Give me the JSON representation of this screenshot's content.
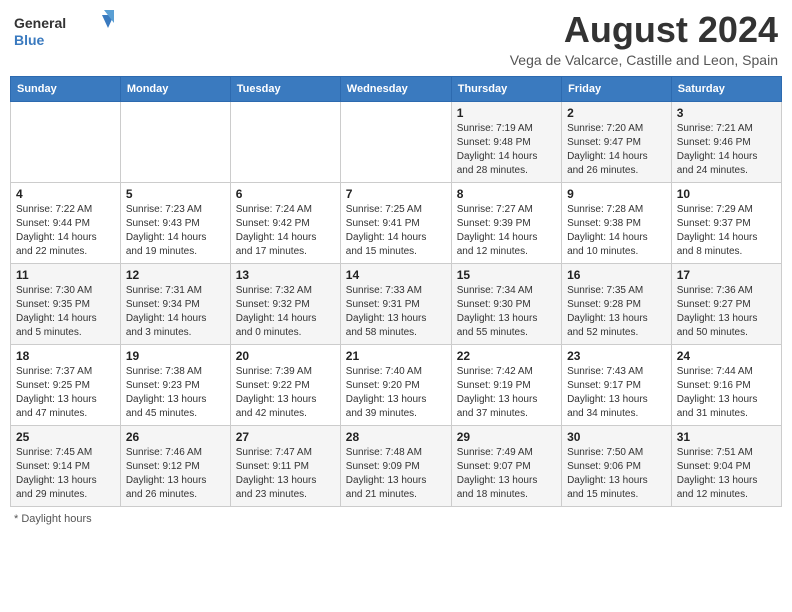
{
  "header": {
    "logo_text_top": "General",
    "logo_text_bottom": "Blue",
    "month_title": "August 2024",
    "location": "Vega de Valcarce, Castille and Leon, Spain"
  },
  "days_of_week": [
    "Sunday",
    "Monday",
    "Tuesday",
    "Wednesday",
    "Thursday",
    "Friday",
    "Saturday"
  ],
  "weeks": [
    [
      {
        "num": "",
        "sunrise": "",
        "sunset": "",
        "daylight": ""
      },
      {
        "num": "",
        "sunrise": "",
        "sunset": "",
        "daylight": ""
      },
      {
        "num": "",
        "sunrise": "",
        "sunset": "",
        "daylight": ""
      },
      {
        "num": "",
        "sunrise": "",
        "sunset": "",
        "daylight": ""
      },
      {
        "num": "1",
        "sunrise": "Sunrise: 7:19 AM",
        "sunset": "Sunset: 9:48 PM",
        "daylight": "Daylight: 14 hours and 28 minutes."
      },
      {
        "num": "2",
        "sunrise": "Sunrise: 7:20 AM",
        "sunset": "Sunset: 9:47 PM",
        "daylight": "Daylight: 14 hours and 26 minutes."
      },
      {
        "num": "3",
        "sunrise": "Sunrise: 7:21 AM",
        "sunset": "Sunset: 9:46 PM",
        "daylight": "Daylight: 14 hours and 24 minutes."
      }
    ],
    [
      {
        "num": "4",
        "sunrise": "Sunrise: 7:22 AM",
        "sunset": "Sunset: 9:44 PM",
        "daylight": "Daylight: 14 hours and 22 minutes."
      },
      {
        "num": "5",
        "sunrise": "Sunrise: 7:23 AM",
        "sunset": "Sunset: 9:43 PM",
        "daylight": "Daylight: 14 hours and 19 minutes."
      },
      {
        "num": "6",
        "sunrise": "Sunrise: 7:24 AM",
        "sunset": "Sunset: 9:42 PM",
        "daylight": "Daylight: 14 hours and 17 minutes."
      },
      {
        "num": "7",
        "sunrise": "Sunrise: 7:25 AM",
        "sunset": "Sunset: 9:41 PM",
        "daylight": "Daylight: 14 hours and 15 minutes."
      },
      {
        "num": "8",
        "sunrise": "Sunrise: 7:27 AM",
        "sunset": "Sunset: 9:39 PM",
        "daylight": "Daylight: 14 hours and 12 minutes."
      },
      {
        "num": "9",
        "sunrise": "Sunrise: 7:28 AM",
        "sunset": "Sunset: 9:38 PM",
        "daylight": "Daylight: 14 hours and 10 minutes."
      },
      {
        "num": "10",
        "sunrise": "Sunrise: 7:29 AM",
        "sunset": "Sunset: 9:37 PM",
        "daylight": "Daylight: 14 hours and 8 minutes."
      }
    ],
    [
      {
        "num": "11",
        "sunrise": "Sunrise: 7:30 AM",
        "sunset": "Sunset: 9:35 PM",
        "daylight": "Daylight: 14 hours and 5 minutes."
      },
      {
        "num": "12",
        "sunrise": "Sunrise: 7:31 AM",
        "sunset": "Sunset: 9:34 PM",
        "daylight": "Daylight: 14 hours and 3 minutes."
      },
      {
        "num": "13",
        "sunrise": "Sunrise: 7:32 AM",
        "sunset": "Sunset: 9:32 PM",
        "daylight": "Daylight: 14 hours and 0 minutes."
      },
      {
        "num": "14",
        "sunrise": "Sunrise: 7:33 AM",
        "sunset": "Sunset: 9:31 PM",
        "daylight": "Daylight: 13 hours and 58 minutes."
      },
      {
        "num": "15",
        "sunrise": "Sunrise: 7:34 AM",
        "sunset": "Sunset: 9:30 PM",
        "daylight": "Daylight: 13 hours and 55 minutes."
      },
      {
        "num": "16",
        "sunrise": "Sunrise: 7:35 AM",
        "sunset": "Sunset: 9:28 PM",
        "daylight": "Daylight: 13 hours and 52 minutes."
      },
      {
        "num": "17",
        "sunrise": "Sunrise: 7:36 AM",
        "sunset": "Sunset: 9:27 PM",
        "daylight": "Daylight: 13 hours and 50 minutes."
      }
    ],
    [
      {
        "num": "18",
        "sunrise": "Sunrise: 7:37 AM",
        "sunset": "Sunset: 9:25 PM",
        "daylight": "Daylight: 13 hours and 47 minutes."
      },
      {
        "num": "19",
        "sunrise": "Sunrise: 7:38 AM",
        "sunset": "Sunset: 9:23 PM",
        "daylight": "Daylight: 13 hours and 45 minutes."
      },
      {
        "num": "20",
        "sunrise": "Sunrise: 7:39 AM",
        "sunset": "Sunset: 9:22 PM",
        "daylight": "Daylight: 13 hours and 42 minutes."
      },
      {
        "num": "21",
        "sunrise": "Sunrise: 7:40 AM",
        "sunset": "Sunset: 9:20 PM",
        "daylight": "Daylight: 13 hours and 39 minutes."
      },
      {
        "num": "22",
        "sunrise": "Sunrise: 7:42 AM",
        "sunset": "Sunset: 9:19 PM",
        "daylight": "Daylight: 13 hours and 37 minutes."
      },
      {
        "num": "23",
        "sunrise": "Sunrise: 7:43 AM",
        "sunset": "Sunset: 9:17 PM",
        "daylight": "Daylight: 13 hours and 34 minutes."
      },
      {
        "num": "24",
        "sunrise": "Sunrise: 7:44 AM",
        "sunset": "Sunset: 9:16 PM",
        "daylight": "Daylight: 13 hours and 31 minutes."
      }
    ],
    [
      {
        "num": "25",
        "sunrise": "Sunrise: 7:45 AM",
        "sunset": "Sunset: 9:14 PM",
        "daylight": "Daylight: 13 hours and 29 minutes."
      },
      {
        "num": "26",
        "sunrise": "Sunrise: 7:46 AM",
        "sunset": "Sunset: 9:12 PM",
        "daylight": "Daylight: 13 hours and 26 minutes."
      },
      {
        "num": "27",
        "sunrise": "Sunrise: 7:47 AM",
        "sunset": "Sunset: 9:11 PM",
        "daylight": "Daylight: 13 hours and 23 minutes."
      },
      {
        "num": "28",
        "sunrise": "Sunrise: 7:48 AM",
        "sunset": "Sunset: 9:09 PM",
        "daylight": "Daylight: 13 hours and 21 minutes."
      },
      {
        "num": "29",
        "sunrise": "Sunrise: 7:49 AM",
        "sunset": "Sunset: 9:07 PM",
        "daylight": "Daylight: 13 hours and 18 minutes."
      },
      {
        "num": "30",
        "sunrise": "Sunrise: 7:50 AM",
        "sunset": "Sunset: 9:06 PM",
        "daylight": "Daylight: 13 hours and 15 minutes."
      },
      {
        "num": "31",
        "sunrise": "Sunrise: 7:51 AM",
        "sunset": "Sunset: 9:04 PM",
        "daylight": "Daylight: 13 hours and 12 minutes."
      }
    ]
  ],
  "footer": {
    "note": "Daylight hours"
  }
}
